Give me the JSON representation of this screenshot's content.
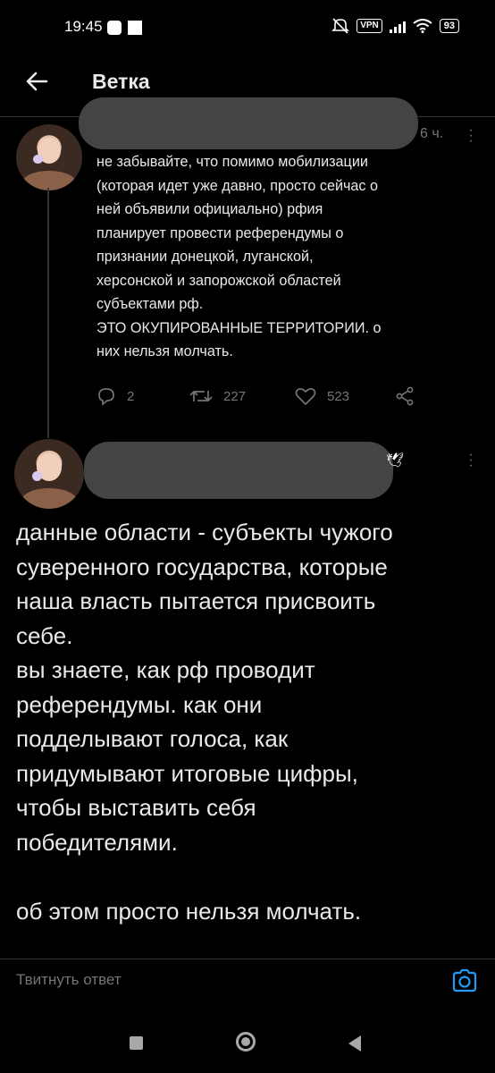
{
  "status_bar": {
    "time": "19:45",
    "vpn_label": "VPN",
    "battery": "93",
    "icons": [
      "mute-icon",
      "vpn-icon",
      "signal-icon",
      "wifi-icon",
      "battery-icon"
    ]
  },
  "header": {
    "title": "Ветка",
    "back_icon": "arrow-left-icon"
  },
  "tweet1": {
    "time": "6 ч.",
    "text": "не забывайте, что помимо мобилизации\n(которая идет уже давно, просто сейчас о\nней объявили официально) рфия\nпланирует провести референдумы о\nпризнании донецкой, луганской,\nхерсонской и запорожской областей\nсубъектами рф.\nЭТО ОКУПИРОВАННЫЕ ТЕРРИТОРИИ. о\nних нельзя молчать.",
    "actions": {
      "replies": "2",
      "retweets": "227",
      "likes": "523"
    }
  },
  "tweet2": {
    "badge_icon": "dove-icon",
    "text": "данные области - субъекты чужого\nсуверенного государства, которые\nнаша власть пытается присвоить\nсебе.\nвы знаете, как рф проводит\nреферендумы. как они\nподделывают голоса, как\nпридумывают итоговые цифры,\nчтобы выставить себя\nпобедителями.\n\nоб этом просто нельзя молчать."
  },
  "reply_bar": {
    "placeholder": "Твитнуть ответ",
    "camera_icon": "camera-icon"
  },
  "colors": {
    "background": "#000000",
    "text": "#e7e9ea",
    "muted": "#71767b",
    "accent": "#1d9bf0",
    "redaction": "#444444"
  }
}
